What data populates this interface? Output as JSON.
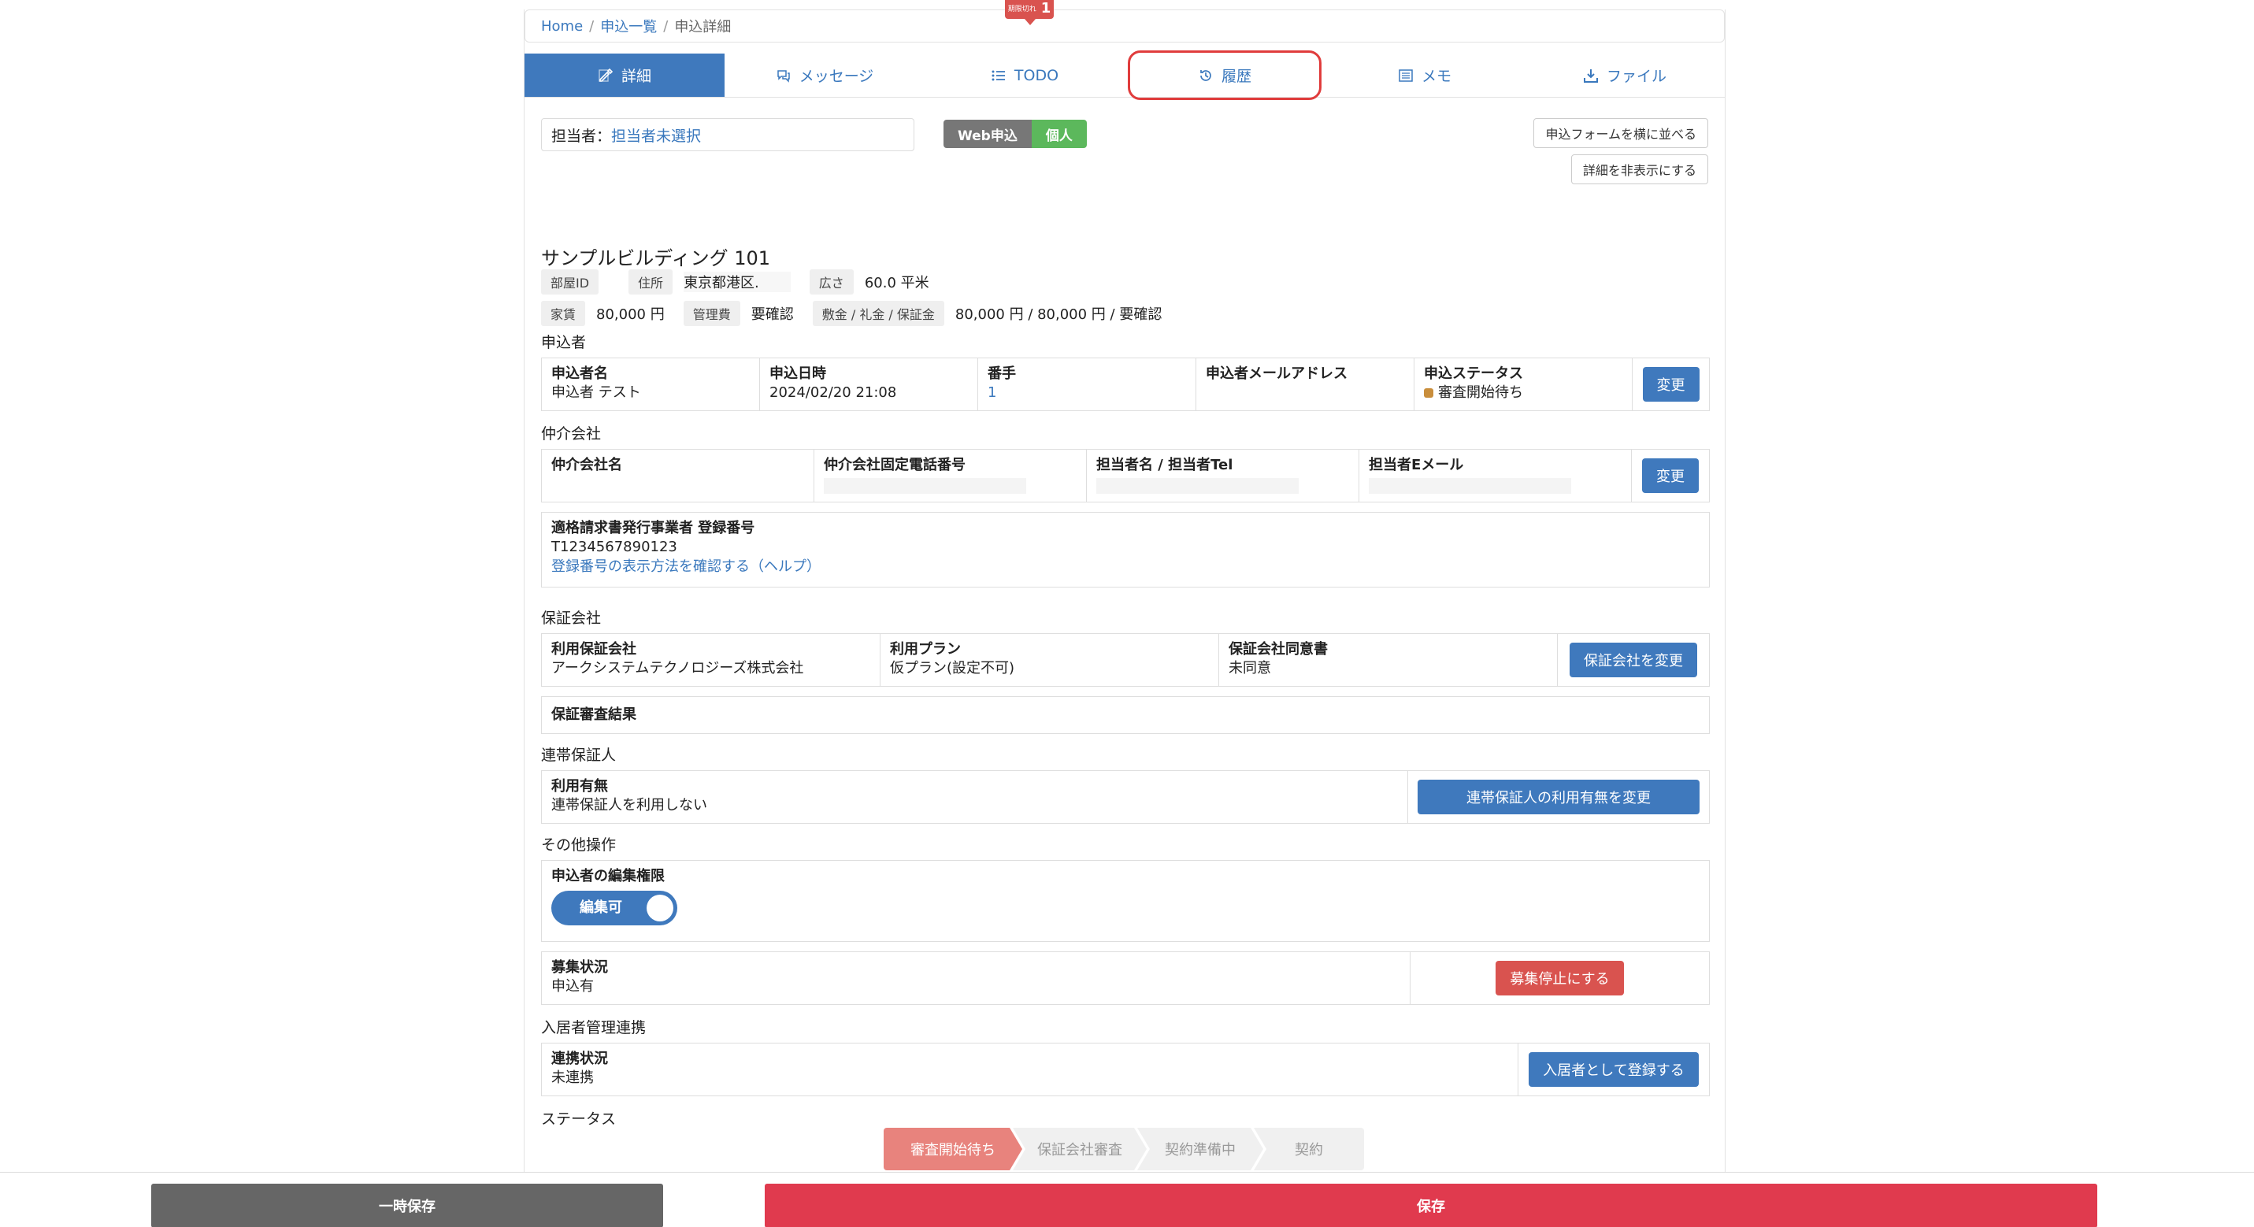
{
  "breadcrumb": [
    {
      "label": "Home",
      "link": true
    },
    {
      "label": "申込一覧",
      "link": true
    },
    {
      "label": "申込詳細",
      "link": false
    }
  ],
  "tabs": [
    {
      "label": "詳細",
      "icon": "edit-icon",
      "active": true
    },
    {
      "label": "メッセージ",
      "icon": "chat-icon"
    },
    {
      "label": "TODO",
      "icon": "list-icon"
    },
    {
      "label": "履歴",
      "icon": "history-icon",
      "highlighted": true
    },
    {
      "label": "メモ",
      "icon": "memo-icon"
    },
    {
      "label": "ファイル",
      "icon": "download-icon"
    }
  ],
  "todo_badge": {
    "small_text": "期限切れ",
    "count": "1"
  },
  "assignee": {
    "label": "担当者：",
    "value": "担当者未選択"
  },
  "tags": {
    "web": "Web申込",
    "personal": "個人"
  },
  "side_buttons": {
    "side_by_side": "申込フォームを横に並べる",
    "hide_details": "詳細を非表示にする"
  },
  "property": {
    "title": "サンプルビルディング 101",
    "room_id_label": "部屋ID",
    "room_id_value": "",
    "address_label": "住所",
    "address_value": "東京都港区.",
    "area_label": "広さ",
    "area_value": "60.0 平米",
    "rent_label": "家賃",
    "rent_value": "80,000 円",
    "mgmt_label": "管理費",
    "mgmt_value": "要確認",
    "deposit_label": "敷金 / 礼金 / 保証金",
    "deposit_value": "80,000 円 / 80,000 円 / 要確認"
  },
  "applicant": {
    "section": "申込者",
    "name_label": "申込者名",
    "name_value": "申込者 テスト",
    "date_label": "申込日時",
    "date_value": "2024/02/20 21:08",
    "order_label": "番手",
    "order_value": "1",
    "email_label": "申込者メールアドレス",
    "email_value": "",
    "status_label": "申込ステータス",
    "status_value": "審査開始待ち",
    "change_button": "変更"
  },
  "broker": {
    "section": "仲介会社",
    "company_label": "仲介会社名",
    "phone_label": "仲介会社固定電話番号",
    "person_label": "担当者名 / 担当者Tel",
    "email_label": "担当者Eメール",
    "change_button": "変更"
  },
  "invoice": {
    "label": "適格請求書発行事業者 登録番号",
    "value": "T1234567890123",
    "help_link": "登録番号の表示方法を確認する（ヘルプ）"
  },
  "guarantor_company": {
    "section": "保証会社",
    "company_label": "利用保証会社",
    "company_value": "アークシステムテクノロジーズ株式会社",
    "plan_label": "利用プラン",
    "plan_value": "仮プラン(設定不可)",
    "consent_label": "保証会社同意書",
    "consent_value": "未同意",
    "change_button": "保証会社を変更",
    "result_label": "保証審査結果"
  },
  "joint_guarantor": {
    "section": "連帯保証人",
    "usage_label": "利用有無",
    "usage_value": "連帯保証人を利用しない",
    "change_button": "連帯保証人の利用有無を変更"
  },
  "other": {
    "section": "その他操作",
    "edit_perm_label": "申込者の編集権限",
    "toggle_label": "編集可",
    "recruit_label": "募集状況",
    "recruit_value": "申込有",
    "stop_button": "募集停止にする"
  },
  "resident": {
    "section": "入居者管理連携",
    "link_label": "連携状況",
    "link_value": "未連携",
    "register_button": "入居者として登録する"
  },
  "status": {
    "section": "ステータス",
    "steps": [
      "審査開始待ち",
      "保証会社審査",
      "契約準備中",
      "契約"
    ]
  },
  "footer": {
    "temp_save": "一時保存",
    "save": "保存"
  },
  "colors": {
    "primary": "#3f79bd",
    "danger": "#d9534f",
    "save": "#e03a4e",
    "temp": "#666666",
    "step_active": "#e8837d"
  }
}
